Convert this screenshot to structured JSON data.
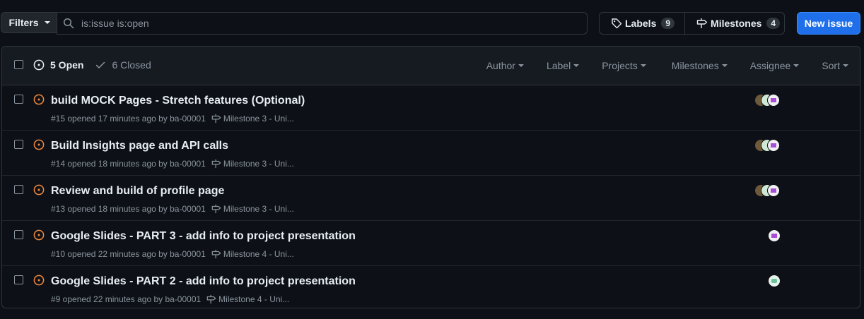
{
  "toolbar": {
    "filters_label": "Filters",
    "search_value": "is:issue is:open",
    "labels_label": "Labels",
    "labels_count": "9",
    "milestones_label": "Milestones",
    "milestones_count": "4",
    "new_issue_label": "New issue"
  },
  "list_header": {
    "open_label": "5 Open",
    "closed_label": "6 Closed",
    "filters": [
      "Author",
      "Label",
      "Projects",
      "Milestones",
      "Assignee",
      "Sort"
    ]
  },
  "issues": [
    {
      "title": "build MOCK Pages - Stretch features (Optional)",
      "meta": "#15 opened 17 minutes ago by ba-00001",
      "milestone": "Milestone 3 - Uni..."
    },
    {
      "title": "Build Insights page and API calls",
      "meta": "#14 opened 18 minutes ago by ba-00001",
      "milestone": "Milestone 3 - Uni..."
    },
    {
      "title": "Review and build of profile page",
      "meta": "#13 opened 18 minutes ago by ba-00001",
      "milestone": "Milestone 3 - Uni..."
    },
    {
      "title": "Google Slides - PART 3 - add info to project presentation",
      "meta": "#10 opened 22 minutes ago by ba-00001",
      "milestone": "Milestone 4 - Uni..."
    },
    {
      "title": "Google Slides - PART 2 - add info to project presentation",
      "meta": "#9 opened 22 minutes ago by ba-00001",
      "milestone": "Milestone 4 - Uni..."
    }
  ],
  "colors": {
    "open_icon": "#f0883e",
    "accent": "#1f6feb",
    "bg": "#0d1117"
  }
}
